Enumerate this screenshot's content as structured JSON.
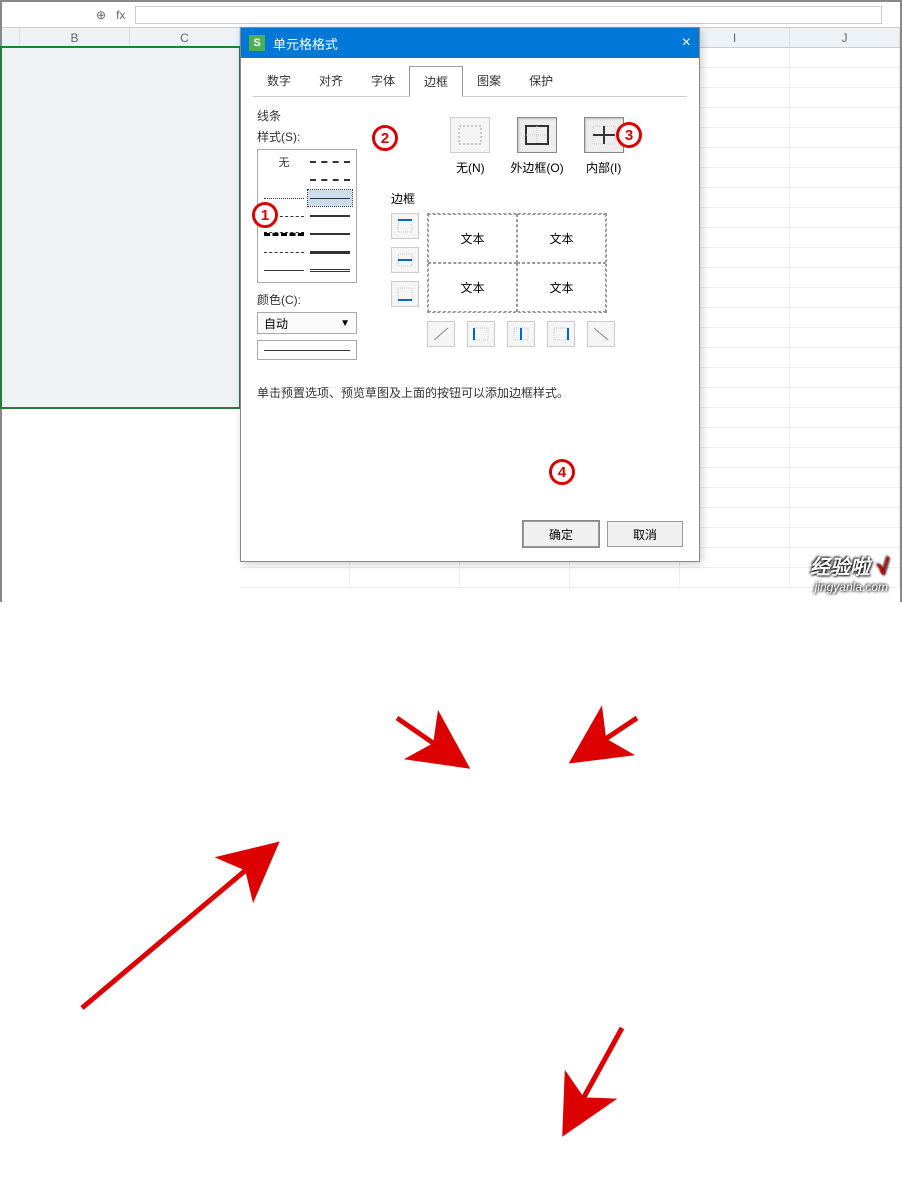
{
  "formula_bar": {
    "fx_label": "fx"
  },
  "columns": [
    "B",
    "C",
    "",
    "",
    "",
    "",
    "I",
    "J"
  ],
  "dialog": {
    "title": "单元格格式",
    "close": "×",
    "tabs": {
      "number": "数字",
      "align": "对齐",
      "font": "字体",
      "border": "边框",
      "pattern": "图案",
      "protect": "保护"
    },
    "line_section": "线条",
    "style_label": "样式(S):",
    "none_label": "无",
    "color_label": "颜色(C):",
    "color_value": "自动",
    "presets": {
      "none": "无(N)",
      "outer": "外边框(O)",
      "inner": "内部(I)"
    },
    "border_label": "边框",
    "preview_text": "文本",
    "hint": "单击预置选项、预览草图及上面的按钮可以添加边框样式。",
    "ok": "确定",
    "cancel": "取消"
  },
  "annotations": {
    "n1": "1",
    "n2": "2",
    "n3": "3",
    "n4": "4"
  },
  "watermark": {
    "top": "经验啦",
    "check": "√",
    "bottom": "jingyanla.com"
  }
}
